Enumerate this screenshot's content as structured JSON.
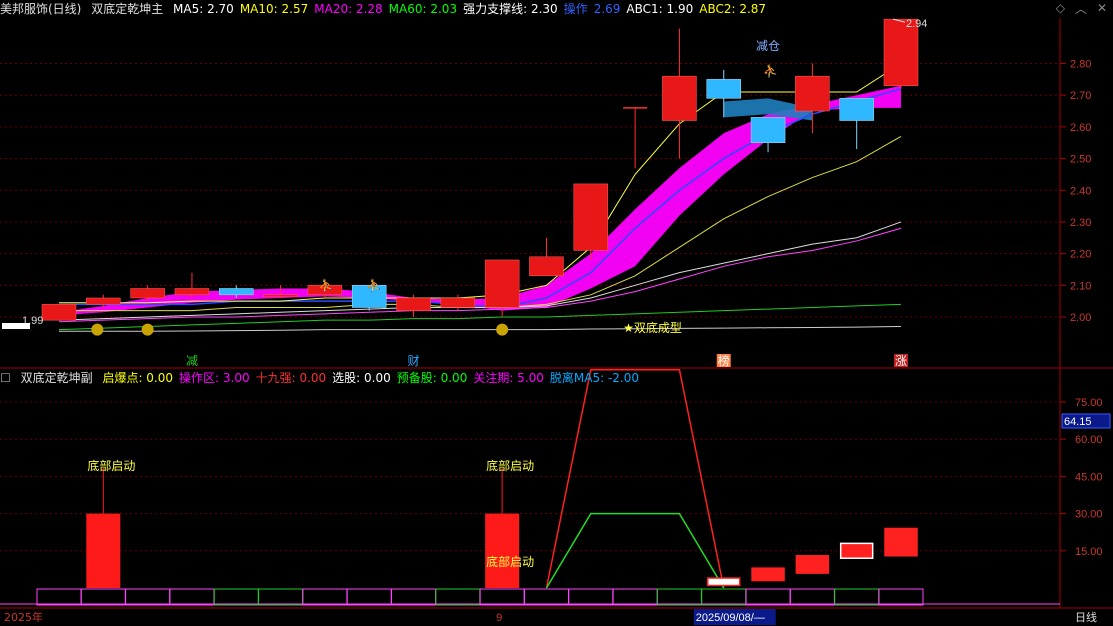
{
  "upper": {
    "stock_name": "美邦服饰(日线)",
    "indicator": "双底定乾坤主",
    "items": [
      {
        "label": "MA5: 2.70",
        "color": "#ffffff"
      },
      {
        "label": "MA10: 2.57",
        "color": "#ffff00"
      },
      {
        "label": "MA20: 2.28",
        "color": "#ff00ff"
      },
      {
        "label": "MA60: 2.03",
        "color": "#00ff00"
      },
      {
        "label": "强力支撑线: 2.30",
        "color": "#ffffff"
      },
      {
        "label": "操作",
        "color": "#3060ff"
      },
      {
        "label": "2.69",
        "color": "#3060ff"
      },
      {
        "label": "ABC1: 1.90",
        "color": "#ffffff"
      },
      {
        "label": "ABC2: 2.87",
        "color": "#ffff00"
      }
    ],
    "icons": [
      "diamond-icon",
      "chevron-up-icon",
      "close-icon"
    ]
  },
  "lower": {
    "indicator": "双底定乾坤副",
    "items": [
      {
        "label": "启爆点: 0.00",
        "color": "#ffff00"
      },
      {
        "label": "操作区: 3.00",
        "color": "#ff00ff"
      },
      {
        "label": "十九强: 0.00",
        "color": "#ff3030"
      },
      {
        "label": "选股: 0.00",
        "color": "#ffffff"
      },
      {
        "label": "预备股: 0.00",
        "color": "#00ff00"
      },
      {
        "label": "关注期: 5.00",
        "color": "#ff00ff"
      },
      {
        "label": "脱离MA5: -2.00",
        "color": "#00aaff"
      }
    ]
  },
  "annotations": {
    "max_price": "2.94",
    "min_price": "1.99",
    "reduce": "减仓",
    "double_bottom": "★双底成型",
    "bottom_start": "底部启动",
    "markers": [
      "减",
      "财",
      "榜",
      "涨"
    ],
    "price_box": "64.15"
  },
  "bottom": {
    "year": "2025年",
    "month": "9",
    "date": "2025/09/08/—",
    "period": "日线"
  },
  "chart_data": [
    {
      "type": "candlestick",
      "title": "美邦服饰(日线)",
      "y_ticks": [
        2.0,
        2.1,
        2.2,
        2.3,
        2.4,
        2.5,
        2.6,
        2.7,
        2.8
      ],
      "ylim": [
        1.905,
        2.98
      ],
      "candles": [
        {
          "o": 1.99,
          "c": 2.04,
          "h": 2.04,
          "l": 1.99
        },
        {
          "o": 2.04,
          "c": 2.06,
          "h": 2.07,
          "l": 2.03
        },
        {
          "o": 2.06,
          "c": 2.09,
          "h": 2.1,
          "l": 2.05
        },
        {
          "o": 2.07,
          "c": 2.09,
          "h": 2.14,
          "l": 2.06
        },
        {
          "o": 2.09,
          "c": 2.07,
          "h": 2.1,
          "l": 2.06
        },
        {
          "o": 2.07,
          "c": 2.07,
          "h": 2.1,
          "l": 2.06
        },
        {
          "o": 2.07,
          "c": 2.1,
          "h": 2.11,
          "l": 2.06
        },
        {
          "o": 2.1,
          "c": 2.03,
          "h": 2.1,
          "l": 2.02
        },
        {
          "o": 2.02,
          "c": 2.06,
          "h": 2.07,
          "l": 2.0
        },
        {
          "o": 2.03,
          "c": 2.06,
          "h": 2.07,
          "l": 2.02
        },
        {
          "o": 2.03,
          "c": 2.18,
          "h": 2.18,
          "l": 2.0
        },
        {
          "o": 2.13,
          "c": 2.19,
          "h": 2.25,
          "l": 2.13
        },
        {
          "o": 2.21,
          "c": 2.42,
          "h": 2.42,
          "l": 2.18
        },
        {
          "o": null,
          "c": null,
          "h": 2.66,
          "l": 2.47,
          "doji": true
        },
        {
          "o": 2.62,
          "c": 2.76,
          "h": 2.91,
          "l": 2.5
        },
        {
          "o": 2.75,
          "c": 2.69,
          "h": 2.78,
          "l": 2.63
        },
        {
          "o": 2.63,
          "c": 2.55,
          "h": 2.63,
          "l": 2.52
        },
        {
          "o": 2.65,
          "c": 2.76,
          "h": 2.8,
          "l": 2.58
        },
        {
          "o": 2.69,
          "c": 2.62,
          "h": 2.69,
          "l": 2.53
        },
        {
          "o": 2.73,
          "c": 2.94,
          "h": 2.94,
          "l": 2.72
        }
      ]
    },
    {
      "type": "bar",
      "title": "双底定乾坤副",
      "y_ticks": [
        15.0,
        30.0,
        45.0,
        60.0,
        75.0
      ],
      "ylim": [
        0,
        92
      ],
      "series": [
        {
          "name": "启爆点",
          "values": [
            0,
            30,
            0,
            0,
            0,
            0,
            0,
            0,
            0,
            0,
            30,
            0,
            0,
            0,
            0,
            0,
            0,
            0,
            0,
            0
          ]
        },
        {
          "name": "十九强",
          "values": [
            0,
            0,
            0,
            0,
            0,
            0,
            0,
            0,
            0,
            0,
            0,
            0,
            88,
            88,
            0,
            0,
            0,
            0,
            0,
            0
          ]
        },
        {
          "name": "操作区",
          "values": [
            0,
            0,
            0,
            0,
            0,
            0,
            0,
            0,
            0,
            0,
            0,
            0,
            30,
            30,
            0,
            0,
            0,
            0,
            0,
            0
          ]
        }
      ]
    }
  ]
}
